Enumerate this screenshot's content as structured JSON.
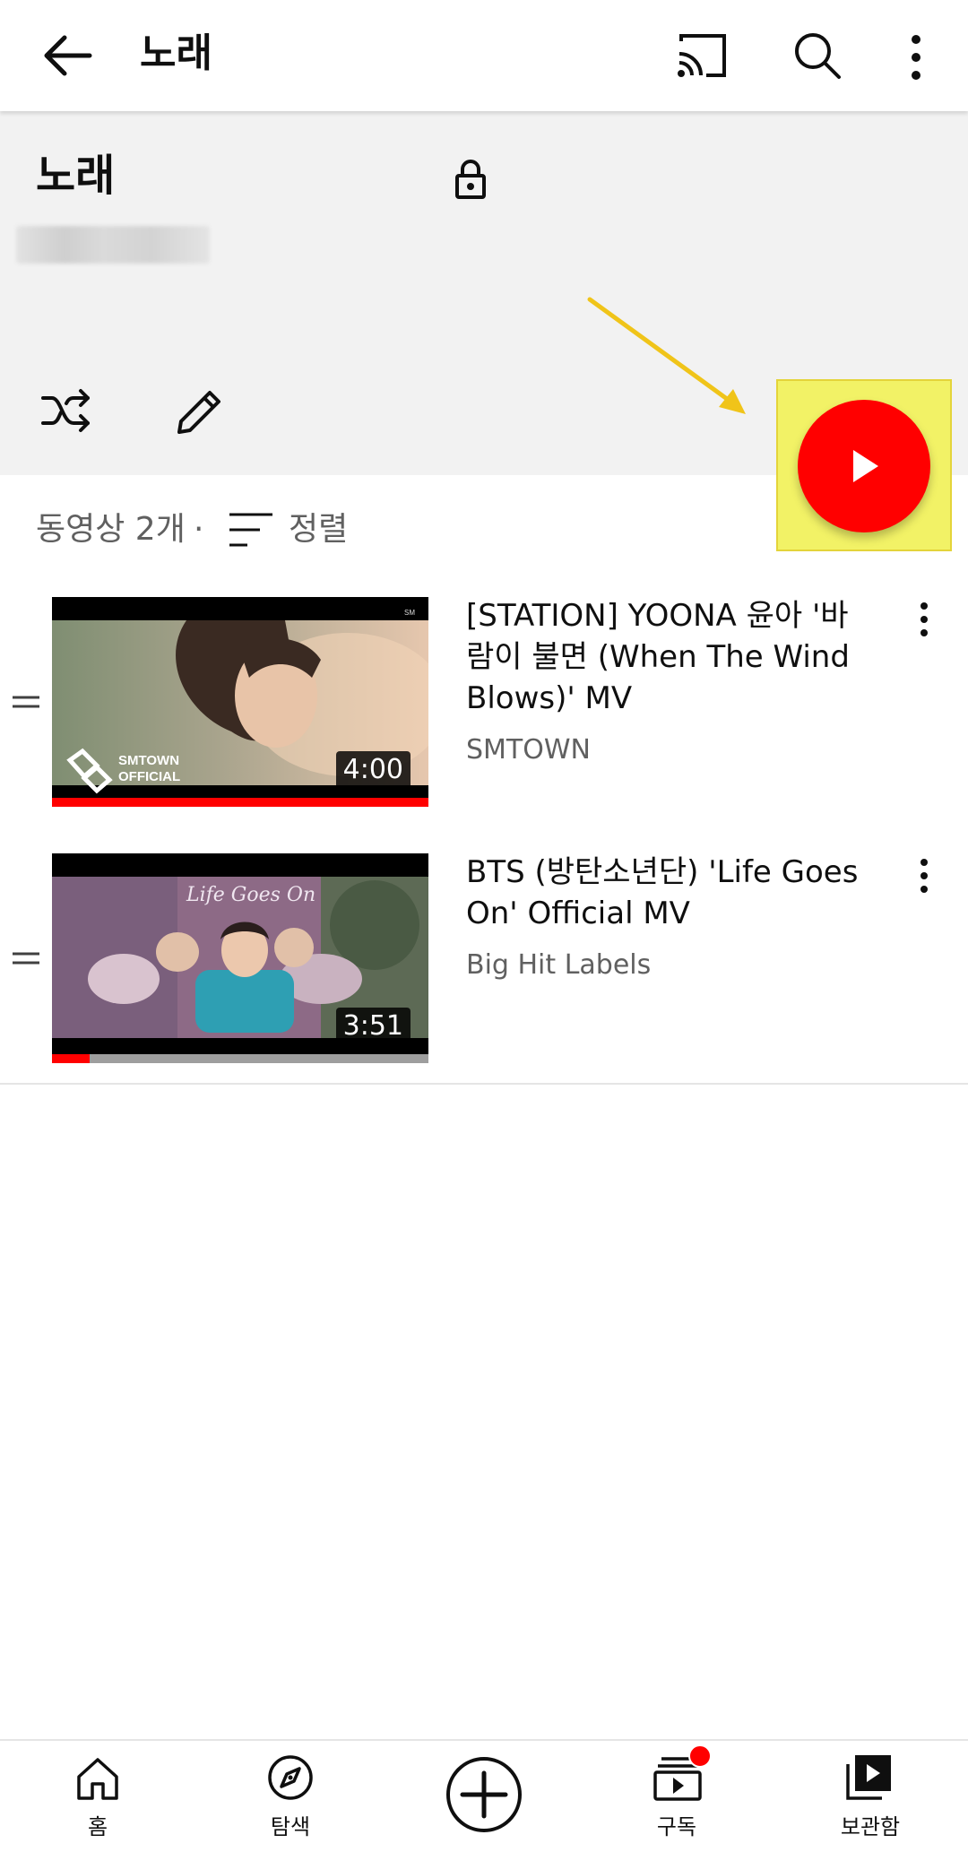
{
  "appbar": {
    "title": "노래",
    "icons": [
      "back-arrow-icon",
      "cast-icon",
      "search-icon",
      "more-vert-icon"
    ]
  },
  "playlist": {
    "title": "노래",
    "privacy_icon": "lock-icon",
    "action_icons": [
      "shuffle-icon",
      "edit-icon",
      "play-icon"
    ],
    "count_label": "동영상 2개",
    "separator": "·",
    "sort_label": "정렬"
  },
  "videos": [
    {
      "title": "[STATION] YOONA 윤아 '바람이 불면 (When The Wind Blows)' MV",
      "channel": "SMTOWN",
      "duration": "4:00",
      "progress": 1.0,
      "thumb_brand_top": "SMTOWN",
      "thumb_brand_bottom": "OFFICIAL"
    },
    {
      "title": "BTS (방탄소년단) 'Life Goes On' Official MV",
      "channel": "Big Hit Labels",
      "duration": "3:51",
      "progress": 0.1,
      "thumb_caption": "Life Goes On"
    }
  ],
  "bottom_nav": [
    {
      "label": "홈",
      "icon": "home-icon"
    },
    {
      "label": "탐색",
      "icon": "explore-icon"
    },
    {
      "label": "",
      "icon": "create-plus-icon"
    },
    {
      "label": "구독",
      "icon": "subscriptions-icon"
    },
    {
      "label": "보관함",
      "icon": "library-icon"
    }
  ],
  "colors": {
    "brand_red": "#ff0000",
    "annotation_highlight": "#f2f266",
    "annotation_arrow": "#f0c419",
    "header_bg": "#f2f2f2",
    "secondary_text": "#606060"
  }
}
